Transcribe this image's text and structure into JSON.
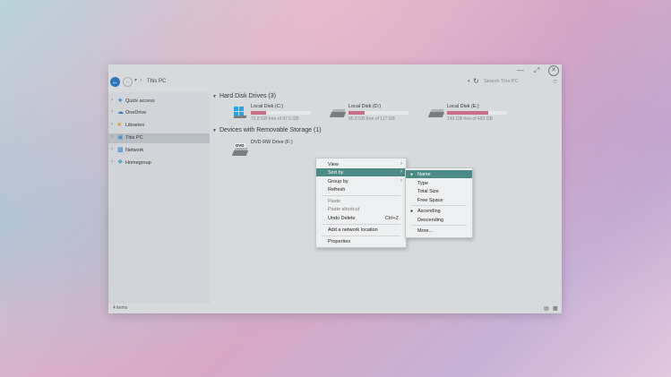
{
  "window": {
    "address_path": "This PC",
    "search_placeholder": "Search This PC"
  },
  "sidebar": {
    "items": [
      {
        "label": "Quick access",
        "icon": "star-icon"
      },
      {
        "label": "OneDrive",
        "icon": "cloud-icon"
      },
      {
        "label": "Libraries",
        "icon": "folder-icon"
      },
      {
        "label": "This PC",
        "icon": "computer-icon",
        "selected": true
      },
      {
        "label": "Network",
        "icon": "network-icon"
      },
      {
        "label": "Homegroup",
        "icon": "homegroup-icon"
      }
    ]
  },
  "content": {
    "hdd_group": "Hard Disk Drives (3)",
    "removable_group": "Devices with Removable Storage (1)",
    "drives": [
      {
        "name": "Local Disk (C:)",
        "free": "72.8 GB free of 97.6 GB",
        "used_fraction": 0.25
      },
      {
        "name": "Local Disk (D:)",
        "free": "85.0 GB free of 117 GB",
        "used_fraction": 0.27
      },
      {
        "name": "Local Disk (E:)",
        "free": "149 GB free of 483 GB",
        "used_fraction": 0.69
      }
    ],
    "dvd": {
      "name": "DVD RW Drive (F:)",
      "badge": "DVD"
    }
  },
  "status": {
    "items_count": "4 items"
  },
  "context_menu": {
    "view": "View",
    "sort_by": "Sort by",
    "group_by": "Group by",
    "refresh": "Refresh",
    "paste": "Paste",
    "paste_shortcut": "Paste shortcut",
    "undo_delete": "Undo Delete",
    "undo_shortcut": "Ctrl+Z",
    "add_network_location": "Add a network location",
    "properties": "Properties"
  },
  "sort_submenu": {
    "name": "Name",
    "type": "Type",
    "total_size": "Total Size",
    "free_space": "Free Space",
    "ascending": "Ascending",
    "descending": "Descending",
    "more": "More..."
  },
  "colors": {
    "accent": "#2d74b8",
    "highlight": "#4c8b86",
    "disk_bar": "#c96f87"
  }
}
